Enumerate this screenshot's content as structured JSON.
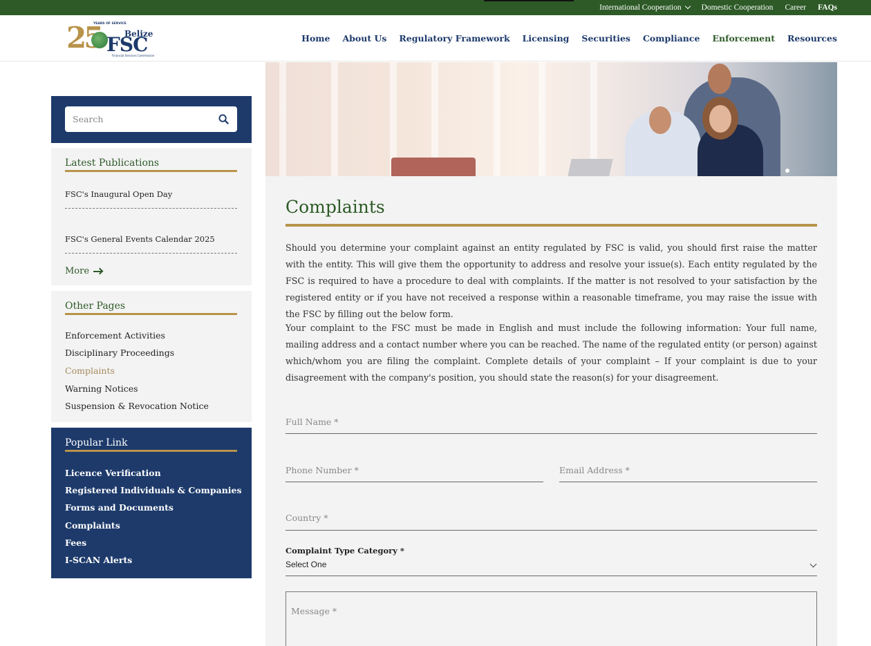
{
  "topbar": {
    "links": [
      "International Cooperation",
      "Domestic Cooperation",
      "Career",
      "FAQs"
    ]
  },
  "logo": {
    "years": "25",
    "tagline": "YEARS OF SERVICE",
    "belize": "Belize",
    "fsc": "FSC",
    "subtitle": "Financial Services Commission"
  },
  "nav": {
    "items": [
      "Home",
      "About Us",
      "Regulatory Framework",
      "Licensing",
      "Securities",
      "Compliance",
      "Enforcement",
      "Resources"
    ],
    "active": "Enforcement"
  },
  "sidebar": {
    "search_placeholder": "Search",
    "latest_publications": {
      "title": "Latest Publications",
      "items": [
        "FSC's Inaugural Open Day",
        "FSC's General Events Calendar 2025"
      ],
      "more_label": "More"
    },
    "other_pages": {
      "title": "Other Pages",
      "items": [
        "Enforcement Activities",
        "Disciplinary Proceedings",
        "Complaints",
        "Warning Notices",
        "Suspension & Revocation Notice"
      ],
      "active": "Complaints"
    },
    "popular_link": {
      "title": "Popular Link",
      "items": [
        "Licence Verification",
        "Registered Individuals & Companies",
        "Forms and Documents",
        "Complaints",
        "Fees",
        "I-SCAN Alerts"
      ]
    }
  },
  "main": {
    "title": "Complaints",
    "paragraph1": "Should you determine your complaint against an entity regulated by FSC is valid, you should first raise the matter with the entity. This will give them the opportunity to address and resolve your issue(s). Each entity regulated by the FSC is required to have a procedure to deal with complaints. If the matter is not resolved to your satisfaction by the registered entity or if you have not received a response within a reasonable timeframe, you may raise the issue with the FSC by filling out the below form.",
    "paragraph2": "Your complaint to the FSC must be made in English and must include the following information: Your full name, mailing address and a contact number where you can be reached. The name of the regulated entity (or person) against which/whom you are filing the complaint. Complete details of your complaint – If your complaint is due to your disagreement with the company's position, you should state the reason(s) for your disagreement.",
    "form": {
      "full_name_placeholder": "Full Name *",
      "phone_placeholder": "Phone Number *",
      "email_placeholder": "Email Address *",
      "country_placeholder": "Country *",
      "complaint_type_label": "Complaint Type Category *",
      "complaint_type_value": "Select One",
      "message_placeholder": "Message *"
    }
  },
  "colors": {
    "green": "#2d5a27",
    "navy": "#1d3a6b",
    "gold": "#b8934a",
    "panel": "#f3f3f3"
  }
}
